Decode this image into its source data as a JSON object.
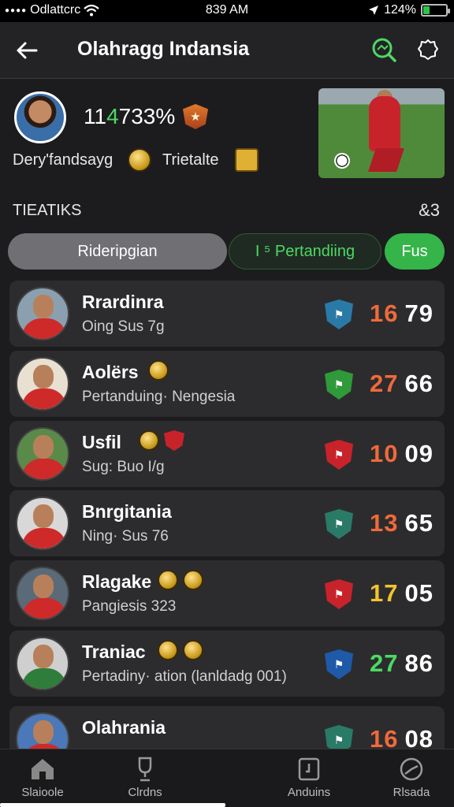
{
  "status": {
    "carrier": "Odlattcrc",
    "time": "839 AM",
    "battery": "124%",
    "battery_level_fraction": 0.3
  },
  "header": {
    "title": "Olahragg Indansia",
    "back_icon": "arrow-left-icon",
    "search_icon": "search-icon",
    "settings_icon": "gear-icon",
    "accent": "#4cd964"
  },
  "profile": {
    "pct_prefix": "11",
    "pct_highlight": "4",
    "pct_suffix": "733%",
    "badge_text": "★",
    "label1": "Dery'fandsayg",
    "label2": "Trietalte"
  },
  "section": {
    "title": "TIEATIKS",
    "count": "&3"
  },
  "tabs": [
    {
      "label": "Rideripgian"
    },
    {
      "label": "I ⁵ Pertandiing"
    },
    {
      "label": "Fus"
    }
  ],
  "cards": [
    {
      "name": "Rrardinra",
      "sub": "Oing  Sus 7g",
      "score_a": "16",
      "score_b": "79",
      "score_a_color": "#ef6a3a",
      "shield_color": "#2a7aa8",
      "coins": []
    },
    {
      "name": "Aolërs",
      "sub": "Pertanduing· Nengesia",
      "score_a": "27",
      "score_b": "66",
      "score_a_color": "#ef6a3a",
      "shield_color": "#2f9a3a",
      "coins": [
        "coin"
      ]
    },
    {
      "name": "Usfil",
      "sub": "Sug: Buo I/g",
      "score_a": "10",
      "score_b": "09",
      "score_a_color": "#ef6a3a",
      "shield_color": "#c8232b",
      "coins": [
        "coin",
        "shield"
      ]
    },
    {
      "name": "Bnrgitania",
      "sub": "Ning· Sus 76",
      "score_a": "13",
      "score_b": "65",
      "score_a_color": "#ef6a3a",
      "shield_color": "#2a7a68",
      "coins": []
    },
    {
      "name": "Rlagake",
      "sub": "Pangiesis 323",
      "score_a": "17",
      "score_b": "05",
      "score_a_color": "#f2c230",
      "shield_color": "#c8232b",
      "coins": [
        "coin",
        "coin"
      ]
    },
    {
      "name": "Traniac",
      "sub": "Pertadiny· ation (lanldadg 001)",
      "score_a": "27",
      "score_b": "86",
      "score_a_color": "#4cd964",
      "shield_color": "#1e5aa8",
      "coins": [
        "coin",
        "coin"
      ]
    },
    {
      "name": "Olahrania",
      "sub": "",
      "score_a": "16",
      "score_b": "08",
      "score_a_color": "#ef6a3a",
      "shield_color": "#2a7a68",
      "coins": []
    }
  ],
  "bottom_nav": [
    {
      "label": "Slaioole",
      "icon": "home-icon"
    },
    {
      "label": "Clrdns",
      "icon": "trophy-icon"
    },
    {
      "label": "Anduins",
      "icon": "calendar-icon"
    },
    {
      "label": "Rlsada",
      "icon": "clock-icon"
    }
  ]
}
